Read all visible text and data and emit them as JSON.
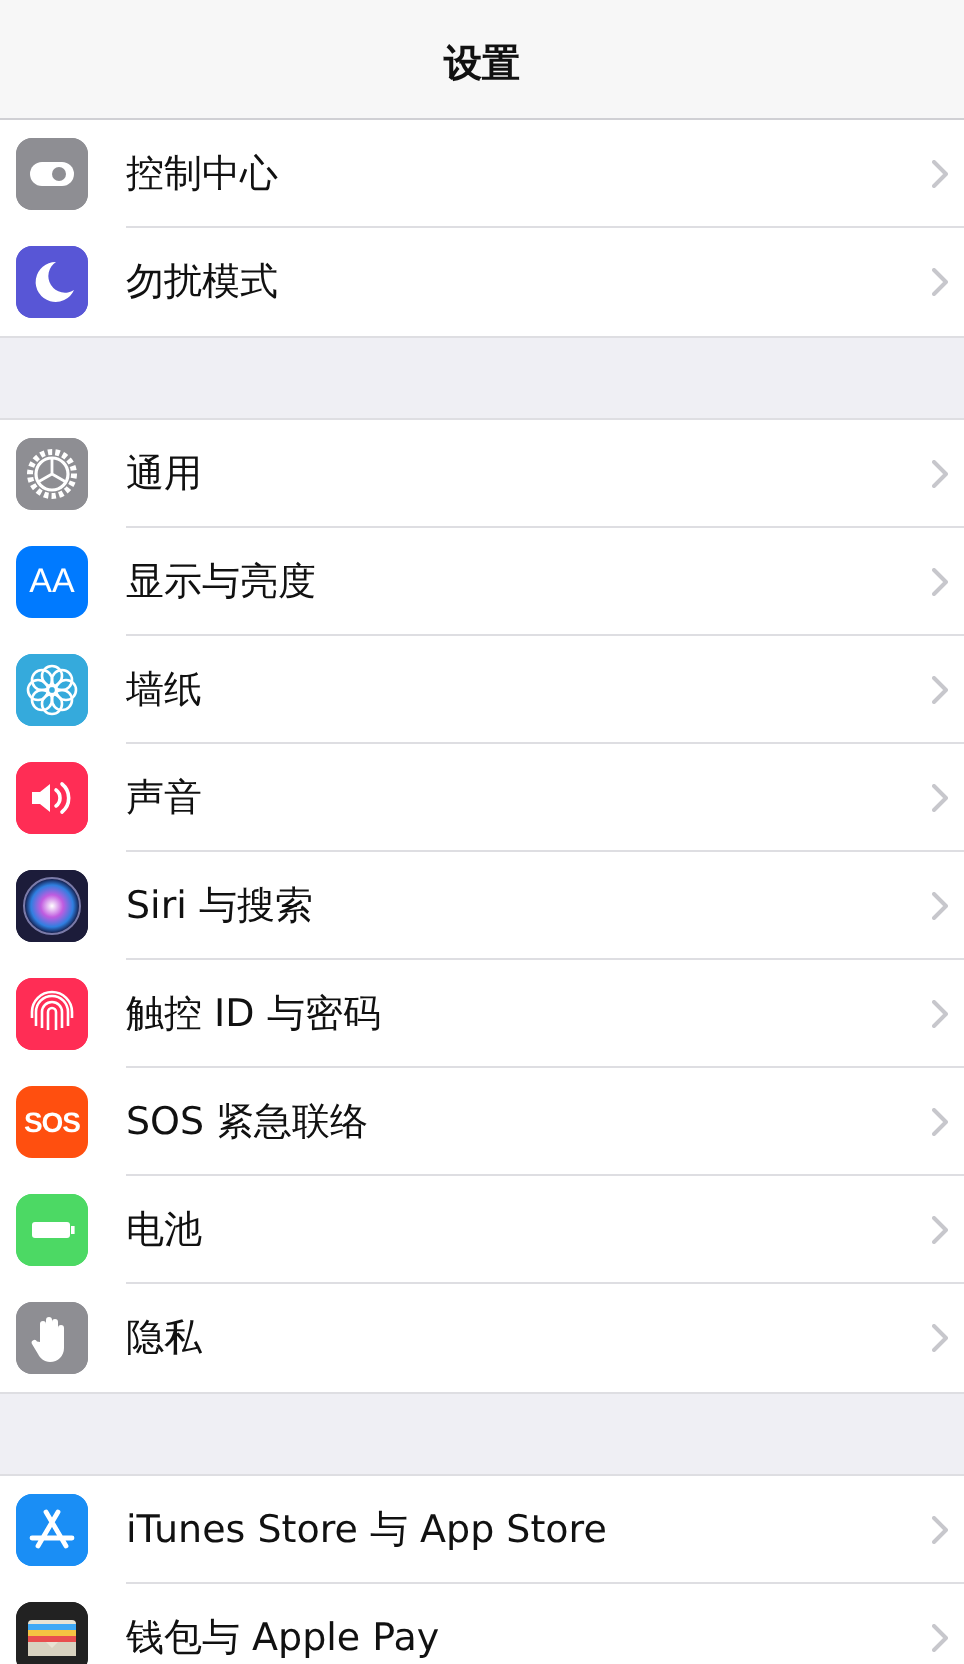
{
  "nav_bar": {
    "title": "设置"
  },
  "groups": [
    {
      "rows": [
        {
          "label": "控制中心"
        },
        {
          "label": "勿扰模式"
        }
      ]
    },
    {
      "rows": [
        {
          "label": "通用"
        },
        {
          "label": "显示与亮度",
          "icon_text": "AA"
        },
        {
          "label": "墙纸"
        },
        {
          "label": "声音"
        },
        {
          "label": "Siri 与搜索"
        },
        {
          "label": "触控 ID 与密码"
        },
        {
          "label": "SOS 紧急联络",
          "icon_text": "SOS"
        },
        {
          "label": "电池"
        },
        {
          "label": "隐私"
        }
      ]
    },
    {
      "rows": [
        {
          "label": "iTunes Store 与 App Store"
        },
        {
          "label": "钱包与 Apple Pay"
        }
      ]
    }
  ]
}
